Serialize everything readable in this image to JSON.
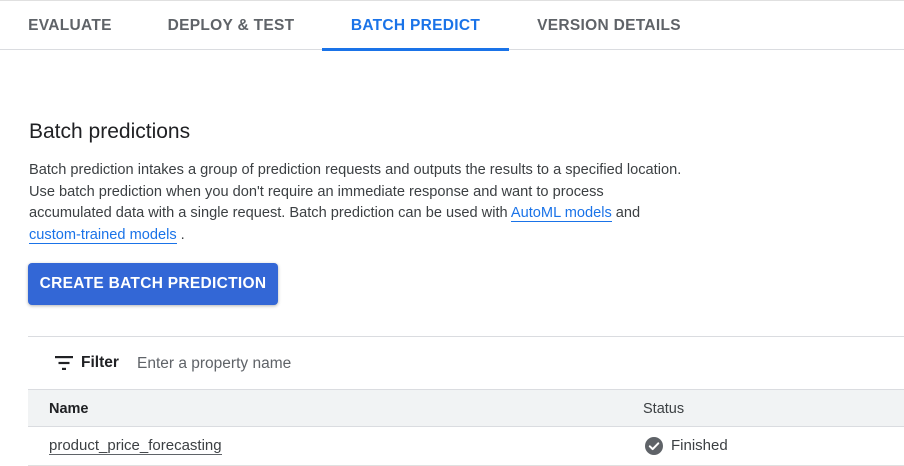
{
  "tabs": [
    {
      "label": "EVALUATE",
      "active": false
    },
    {
      "label": "DEPLOY & TEST",
      "active": false
    },
    {
      "label": "BATCH PREDICT",
      "active": true
    },
    {
      "label": "VERSION DETAILS",
      "active": false
    }
  ],
  "section": {
    "title": "Batch predictions",
    "desc_part1": "Batch prediction intakes a group of prediction requests and outputs the results to a specified location. Use batch prediction when you don't require an immediate response and want to process accumulated data with a single request. Batch prediction can be used with ",
    "link_automl": "AutoML models",
    "desc_part2": " and ",
    "link_custom": "custom-trained models",
    "desc_part3": " ."
  },
  "create_button": "CREATE BATCH PREDICTION",
  "filter": {
    "label": "Filter",
    "placeholder": "Enter a property name",
    "icon": "filter-icon"
  },
  "table": {
    "columns": [
      "Name",
      "Status"
    ],
    "rows": [
      {
        "name": "product_price_forecasting",
        "status": "Finished",
        "status_icon": "check-circle-icon"
      }
    ]
  },
  "colors": {
    "accent": "#1a73e8",
    "button": "#3367d6",
    "status_icon": "#5f6368"
  }
}
